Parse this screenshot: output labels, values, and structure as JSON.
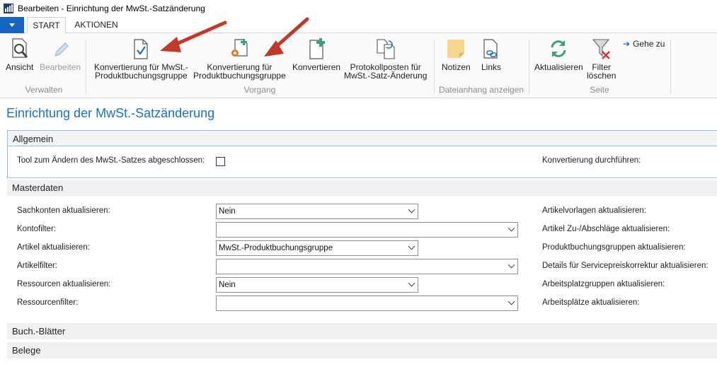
{
  "window": {
    "title": "Bearbeiten - Einrichtung der MwSt.-Satzänderung"
  },
  "ribbon": {
    "tabs": [
      {
        "label": "START",
        "active": true
      },
      {
        "label": "AKTIONEN",
        "active": false
      }
    ],
    "buttons": {
      "ansicht": "Ansicht",
      "bearbeiten": "Bearbeiten",
      "konv_mwst_line1": "Konvertierung für MwSt.-",
      "konv_mwst_line2": "Produktbuchungsgruppe",
      "konv_prod_line1": "Konvertierung für",
      "konv_prod_line2": "Produktbuchungsgruppe",
      "konvertieren": "Konvertieren",
      "protokoll_line1": "Protokollposten für",
      "protokoll_line2": "MwSt.-Satz-Änderung",
      "notizen": "Notizen",
      "links": "Links",
      "aktualisieren": "Aktualisieren",
      "filter_line1": "Filter",
      "filter_line2": "löschen",
      "gehe_zu": "Gehe zu"
    },
    "groups": {
      "verwalten": "Verwalten",
      "vorgang": "Vorgang",
      "dateianhang": "Dateianhang anzeigen",
      "seite": "Seite"
    },
    "colors": {
      "accent": "#1565c0",
      "arrow_red": "#c0392b"
    }
  },
  "page": {
    "title": "Einrichtung der MwSt.-Satzänderung",
    "sections": {
      "allgemein": "Allgemein",
      "masterdaten": "Masterdaten",
      "buch_blaetter": "Buch.-Blätter",
      "belege": "Belege"
    },
    "allgemein": {
      "tool_label": "Tool zum Ändern des MwSt.-Satzes abgeschlossen:",
      "tool_checked": false,
      "konvertierung_label": "Konvertierung durchführen:"
    },
    "masterdaten": {
      "left": [
        {
          "label": "Sachkonten aktualisieren:",
          "value": "Nein"
        },
        {
          "label": "Kontofilter:",
          "value": ""
        },
        {
          "label": "Artikel aktualisieren:",
          "value": "MwSt.-Produktbuchungsgruppe"
        },
        {
          "label": "Artikelfilter:",
          "value": ""
        },
        {
          "label": "Ressourcen aktualisieren:",
          "value": "Nein"
        },
        {
          "label": "Ressourcenfilter:",
          "value": ""
        }
      ],
      "right": [
        "Artikelvorlagen aktualisieren:",
        "Artikel Zu-/Abschläge aktualisieren:",
        "Produktbuchungsgruppen aktualisieren:",
        "Details für Servicepreiskorrektur aktualisieren:",
        "Arbeitsplatzgruppen aktualisieren:",
        "Arbeitsplätze aktualisieren:"
      ]
    }
  }
}
